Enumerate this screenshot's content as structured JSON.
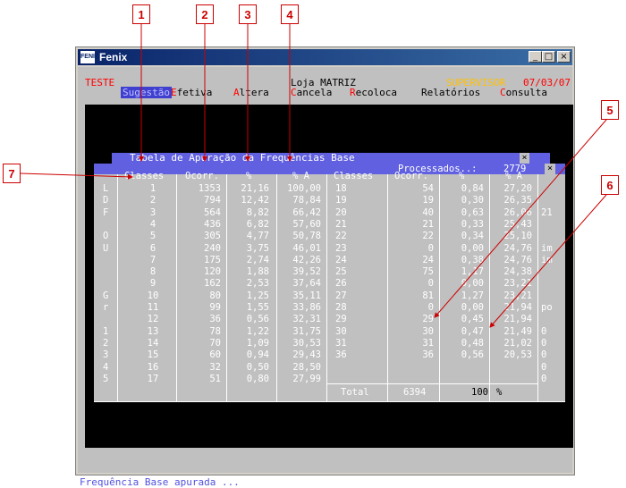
{
  "callouts": [
    "1",
    "2",
    "3",
    "4",
    "5",
    "6",
    "7"
  ],
  "window": {
    "title": "Fenix",
    "logo": "FENIX",
    "minimize": "_",
    "maximize": "□",
    "close": "×"
  },
  "header": {
    "left": "TESTE",
    "center": "Loja MATRIZ",
    "user": "SUPERVISOR",
    "date": "07/03/07",
    "accent_color": "#ff0000",
    "user_color": "#ffc000"
  },
  "menu": [
    {
      "hot": "",
      "rest": "Sugestão",
      "selected": true
    },
    {
      "hot": "E",
      "rest": "fetiva"
    },
    {
      "hot": "A",
      "rest": "ltera"
    },
    {
      "hot": "C",
      "rest": "ancela"
    },
    {
      "hot": "R",
      "rest": "ecoloca"
    },
    {
      "hot": "",
      "rest": "Relatórios"
    },
    {
      "hot": "C",
      "rest": "onsulta"
    }
  ],
  "dialog": {
    "title": "Tabela de Apuração da Frequências Base",
    "close": "×",
    "processed_label": "Processados..:",
    "processed_value": "2779",
    "outer_close": "×",
    "headers_left": [
      "Classes",
      "Ocorr.",
      "%",
      "% A"
    ],
    "headers_right": [
      "Classes",
      "Ocorr.",
      "%",
      "% A"
    ],
    "rows_left": [
      [
        "1",
        "1353",
        "21,16",
        "100,00"
      ],
      [
        "2",
        "794",
        "12,42",
        "78,84"
      ],
      [
        "3",
        "564",
        "8,82",
        "66,42"
      ],
      [
        "4",
        "436",
        "6,82",
        "57,60"
      ],
      [
        "5",
        "305",
        "4,77",
        "50,78"
      ],
      [
        "6",
        "240",
        "3,75",
        "46,01"
      ],
      [
        "7",
        "175",
        "2,74",
        "42,26"
      ],
      [
        "8",
        "120",
        "1,88",
        "39,52"
      ],
      [
        "9",
        "162",
        "2,53",
        "37,64"
      ],
      [
        "10",
        "80",
        "1,25",
        "35,11"
      ],
      [
        "11",
        "99",
        "1,55",
        "33,86"
      ],
      [
        "12",
        "36",
        "0,56",
        "32,31"
      ],
      [
        "13",
        "78",
        "1,22",
        "31,75"
      ],
      [
        "14",
        "70",
        "1,09",
        "30,53"
      ],
      [
        "15",
        "60",
        "0,94",
        "29,43"
      ],
      [
        "16",
        "32",
        "0,50",
        "28,50"
      ],
      [
        "17",
        "51",
        "0,80",
        "27,99"
      ]
    ],
    "rows_right": [
      [
        "18",
        "54",
        "0,84",
        "27,20"
      ],
      [
        "19",
        "19",
        "0,30",
        "26,35"
      ],
      [
        "20",
        "40",
        "0,63",
        "26,06"
      ],
      [
        "21",
        "21",
        "0,33",
        "25,43"
      ],
      [
        "22",
        "22",
        "0,34",
        "25,10"
      ],
      [
        "23",
        "0",
        "0,00",
        "24,76"
      ],
      [
        "24",
        "24",
        "0,38",
        "24,76"
      ],
      [
        "25",
        "75",
        "1,17",
        "24,38"
      ],
      [
        "26",
        "0",
        "0,00",
        "23,21"
      ],
      [
        "27",
        "81",
        "1,27",
        "23,21"
      ],
      [
        "28",
        "0",
        "0,00",
        "21,94"
      ],
      [
        "29",
        "29",
        "0,45",
        "21,94"
      ],
      [
        "30",
        "30",
        "0,47",
        "21,49"
      ],
      [
        "31",
        "31",
        "0,48",
        "21,02"
      ],
      [
        "36",
        "36",
        "0,56",
        "20,53"
      ]
    ],
    "total_label": "Total",
    "total_value": "6394",
    "percent_total": "100",
    "percent_sign": "%",
    "side_left": [
      "L",
      "D",
      "F",
      "",
      "O",
      "U",
      "",
      "",
      "",
      "G",
      "r",
      "",
      "1",
      "2",
      "3",
      "4",
      "5"
    ],
    "side_right": [
      "",
      "",
      "21",
      "",
      "",
      "im",
      "im",
      "",
      "",
      "",
      "po",
      "",
      "0",
      "0",
      "0",
      "0",
      "0"
    ]
  },
  "status": "Frequência Base apurada ..."
}
